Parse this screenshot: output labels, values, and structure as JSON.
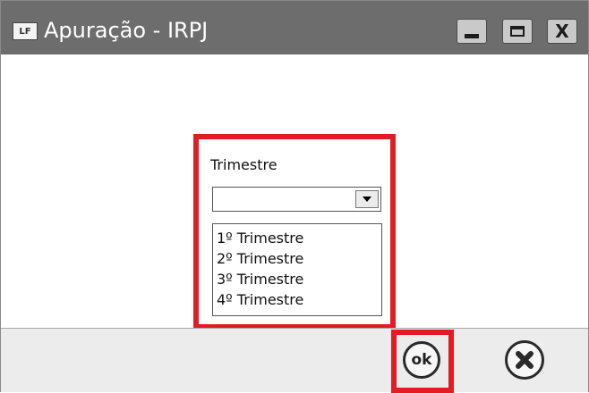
{
  "window": {
    "title": "Apuração - IRPJ",
    "app_icon_text": "LF",
    "controls": {
      "minimize_icon": "minimize-icon",
      "maximize_icon": "maximize-icon",
      "close_icon": "close-icon",
      "close_glyph": "X"
    }
  },
  "form": {
    "field_label": "Trimestre",
    "selected_value": "",
    "options": [
      "1º Trimestre",
      "2º Trimestre",
      "3º Trimestre",
      "4º Trimestre"
    ]
  },
  "footer": {
    "ok_label": "ok",
    "cancel_icon": "cancel-x-icon"
  },
  "colors": {
    "titlebar": "#6d6d6d",
    "highlight": "#e01c24",
    "footer": "#ececec"
  }
}
